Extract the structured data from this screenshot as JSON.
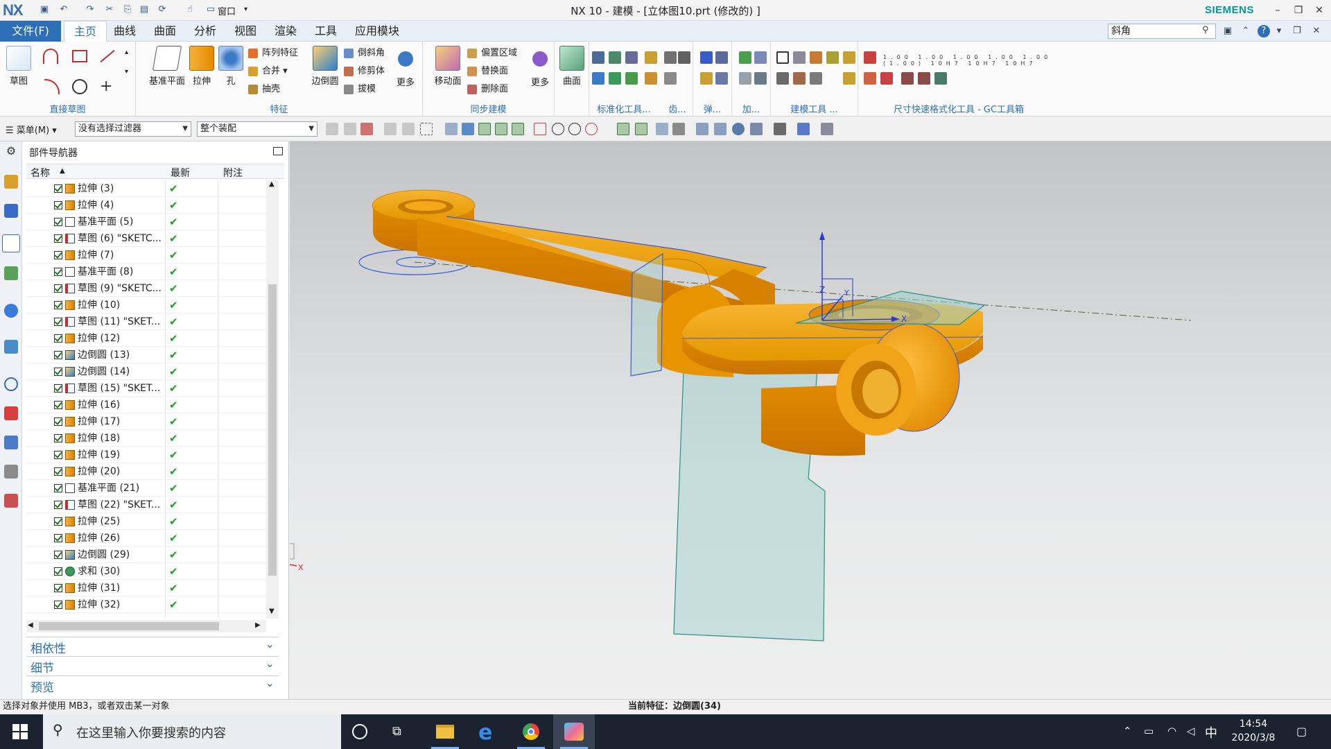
{
  "titlebar": {
    "logo": "NX",
    "title": "NX 10 - 建模 - [立体图10.prt  (修改的) ]",
    "brand": "SIEMENS",
    "window_menu": "窗口"
  },
  "tabs": {
    "file": "文件(F)",
    "items": [
      "主页",
      "曲线",
      "曲面",
      "分析",
      "视图",
      "渲染",
      "工具",
      "应用模块"
    ],
    "active": "主页",
    "command_search_value": "斜角"
  },
  "ribbon": {
    "sketch": "草图",
    "direct_sketch_group": "直接草图",
    "datum_plane": "基准平面",
    "extrude": "拉伸",
    "hole": "孔",
    "pattern_feature": "阵列特征",
    "unite": "合并",
    "shell": "抽壳",
    "edge_blend": "边倒圆",
    "chamfer": "倒斜角",
    "trim_body": "修剪体",
    "draft": "拔模",
    "more": "更多",
    "feature_group": "特征",
    "move_face": "移动面",
    "offset_region": "偏置区域",
    "replace_face": "替换面",
    "delete_face": "删除面",
    "sync_more": "更多",
    "sync_group": "同步建模",
    "surface": "曲面",
    "std_tools": "标准化工具...",
    "gear": "齿...",
    "spring": "弹...",
    "machining": "加...",
    "modeling_tools": "建模工具 ...",
    "dim_tools": "尺寸快速格式化工具 - GC工具箱"
  },
  "seltoolbar": {
    "menu": "菜单(M)",
    "filter": "没有选择过滤器",
    "scope": "整个装配"
  },
  "navigator": {
    "title": "部件导航器",
    "col_name": "名称",
    "col_latest": "最新",
    "col_note": "附注",
    "features": [
      {
        "label": "拉伸 (3)",
        "icon": "extrude-icon"
      },
      {
        "label": "拉伸 (4)",
        "icon": "extrude-icon"
      },
      {
        "label": "基准平面 (5)",
        "icon": "datum-plane-icon"
      },
      {
        "label": "草图 (6) \"SKETC...",
        "icon": "sketch-icon"
      },
      {
        "label": "拉伸 (7)",
        "icon": "extrude-icon"
      },
      {
        "label": "基准平面 (8)",
        "icon": "datum-plane-icon"
      },
      {
        "label": "草图 (9) \"SKETC...",
        "icon": "sketch-icon"
      },
      {
        "label": "拉伸 (10)",
        "icon": "extrude-icon"
      },
      {
        "label": "草图 (11) \"SKET...",
        "icon": "sketch-icon"
      },
      {
        "label": "拉伸 (12)",
        "icon": "extrude-icon"
      },
      {
        "label": "边倒圆 (13)",
        "icon": "edge-blend-icon"
      },
      {
        "label": "边倒圆 (14)",
        "icon": "edge-blend-icon"
      },
      {
        "label": "草图 (15) \"SKET...",
        "icon": "sketch-icon"
      },
      {
        "label": "拉伸 (16)",
        "icon": "extrude-icon"
      },
      {
        "label": "拉伸 (17)",
        "icon": "extrude-icon"
      },
      {
        "label": "拉伸 (18)",
        "icon": "extrude-icon"
      },
      {
        "label": "拉伸 (19)",
        "icon": "extrude-icon"
      },
      {
        "label": "拉伸 (20)",
        "icon": "extrude-icon"
      },
      {
        "label": "基准平面 (21)",
        "icon": "datum-plane-icon"
      },
      {
        "label": "草图 (22) \"SKET...",
        "icon": "sketch-icon"
      },
      {
        "label": "拉伸 (25)",
        "icon": "extrude-icon"
      },
      {
        "label": "拉伸 (26)",
        "icon": "extrude-icon"
      },
      {
        "label": "边倒圆 (29)",
        "icon": "edge-blend-icon"
      },
      {
        "label": "求和 (30)",
        "icon": "unite-icon"
      },
      {
        "label": "拉伸 (31)",
        "icon": "extrude-icon"
      },
      {
        "label": "拉伸 (32)",
        "icon": "extrude-icon"
      }
    ],
    "latest_mark": "✔",
    "panels": [
      "相依性",
      "细节",
      "预览"
    ]
  },
  "graphics": {
    "axis_x": "X",
    "axis_y": "Y",
    "axis_z": "Z",
    "triad_x": "X",
    "triad_z": "Z"
  },
  "status": {
    "prompt": "选择对象并使用 MB3，或者双击某一对象",
    "current_feature": "当前特征：边倒圆(34)"
  },
  "taskbar": {
    "search_placeholder": "在这里输入你要搜索的内容",
    "ime": "中",
    "time": "14:54",
    "date": "2020/3/8"
  },
  "colors": {
    "part_orange": "#f0a00c",
    "accent_blue": "#2c6fb7",
    "brand_teal": "#009999"
  }
}
